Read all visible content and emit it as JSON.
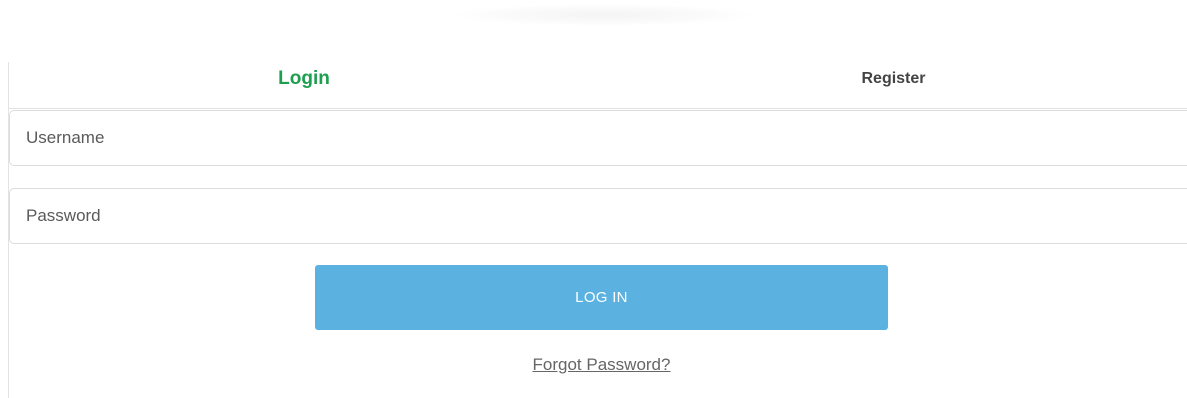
{
  "tabs": {
    "login_label": "Login",
    "register_label": "Register",
    "active": "Login"
  },
  "form": {
    "username": {
      "value": "",
      "placeholder": "Username"
    },
    "password": {
      "value": "",
      "placeholder": "Password"
    },
    "submit_label": "LOG IN",
    "forgot_label": "Forgot Password?"
  },
  "colors": {
    "active_tab": "#1e9e4f",
    "button_bg": "#5bb2e0",
    "button_text": "#ffffff",
    "link_text": "#666666"
  }
}
